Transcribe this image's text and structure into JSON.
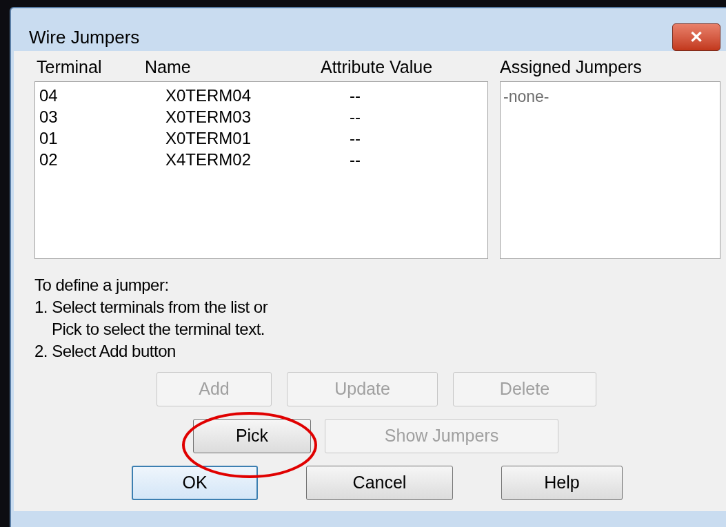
{
  "window": {
    "title": "Wire Jumpers",
    "close": "✕"
  },
  "columns": [
    "Terminal",
    "Name",
    "Attribute Value"
  ],
  "rows": [
    {
      "terminal": "04",
      "name": "X0TERM04",
      "value": "--"
    },
    {
      "terminal": "03",
      "name": "X0TERM03",
      "value": "--"
    },
    {
      "terminal": "01",
      "name": "X0TERM01",
      "value": "--"
    },
    {
      "terminal": "02",
      "name": "X4TERM02",
      "value": "--"
    }
  ],
  "assigned": {
    "header": "Assigned Jumpers",
    "items": [
      "-none-"
    ]
  },
  "instructions": [
    "To define a jumper:",
    "1. Select terminals from the list or",
    "Pick to select the terminal text.",
    "2. Select Add button"
  ],
  "button_rows": [
    [
      {
        "label": "Add",
        "disabled": true,
        "default": false
      },
      {
        "label": "Update",
        "disabled": true,
        "default": false
      },
      {
        "label": "Delete",
        "disabled": true,
        "default": false
      }
    ],
    [
      {
        "label": "Pick",
        "disabled": false,
        "default": false
      },
      {
        "label": "Show Jumpers",
        "disabled": true,
        "default": false
      }
    ],
    [
      {
        "label": "OK",
        "disabled": false,
        "default": true
      },
      {
        "label": "Cancel",
        "disabled": false,
        "default": false
      },
      {
        "label": "Help",
        "disabled": false,
        "default": false
      }
    ]
  ]
}
